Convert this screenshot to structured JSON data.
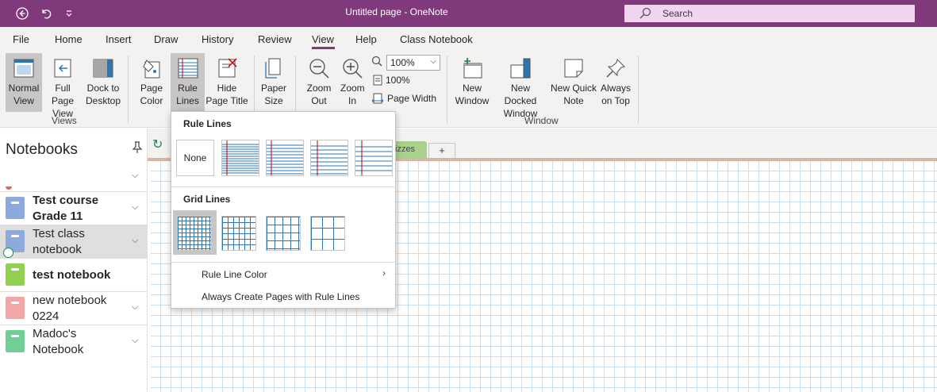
{
  "window": {
    "title": "Untitled page  -  OneNote"
  },
  "search": {
    "placeholder": "Search"
  },
  "menu": {
    "tabs": [
      "File",
      "Home",
      "Insert",
      "Draw",
      "History",
      "Review",
      "View",
      "Help",
      "Class Notebook"
    ],
    "active": "View"
  },
  "ribbon": {
    "views": {
      "label": "Views",
      "normal": "Normal View",
      "full_page": "Full Page View",
      "dock": "Dock to Desktop"
    },
    "page_color": "Page Color",
    "rule_lines": "Rule Lines",
    "hide_page_title": "Hide Page Title",
    "paper_size": "Paper Size",
    "zoom_out": "Zoom Out",
    "zoom_in": "Zoom In",
    "zoom_value": "100%",
    "zoom_100": "100%",
    "page_width": "Page Width",
    "window": {
      "label": "Window",
      "new_window": "New Window",
      "new_docked": "New Docked Window",
      "new_quick_note": "New Quick Note",
      "always_on_top": "Always on Top"
    }
  },
  "notebooks": {
    "title": "Notebooks",
    "items": [
      {
        "name": "Test course Grade 11",
        "color": "#8ea9db",
        "bold": true
      },
      {
        "name": "Test class notebook",
        "color": "#8ea9db",
        "bold": false,
        "selected": true
      },
      {
        "name": "test notebook",
        "color": "#92d050",
        "bold": true
      },
      {
        "name": "new notebook 0224",
        "color": "#f4a6a6",
        "bold": false
      },
      {
        "name": "Madoc's Notebook",
        "color": "#6fcf97",
        "bold": false
      }
    ]
  },
  "section_tabs": {
    "quizzes": "izzes",
    "add": "+"
  },
  "dropdown": {
    "rule_lines_heading": "Rule Lines",
    "none_label": "None",
    "grid_lines_heading": "Grid Lines",
    "rule_line_color": "Rule Line Color",
    "always_create": "Always Create Pages with Rule Lines"
  },
  "colors": {
    "accent": "#80397b",
    "search_bg": "#f1d5ee",
    "grid_line": "#c9dff0",
    "rule_blue": "#2e75b6",
    "margin_red": "#c00000"
  }
}
